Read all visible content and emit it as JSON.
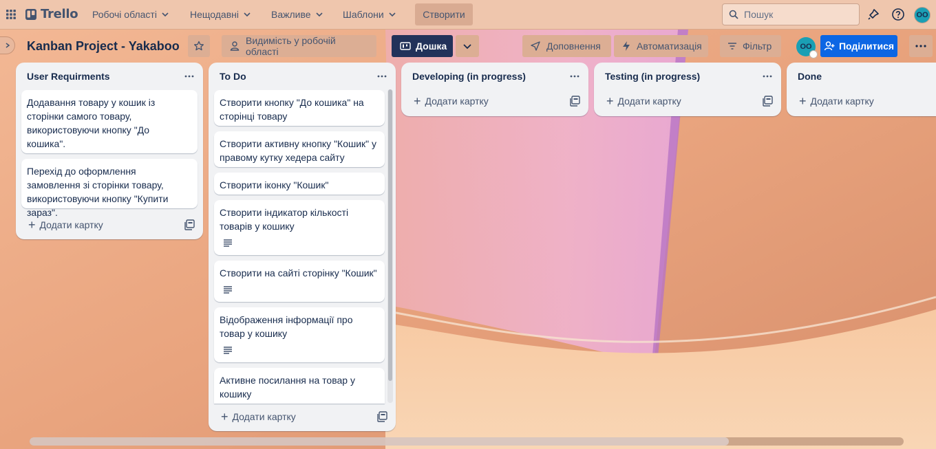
{
  "app": {
    "name": "Trello"
  },
  "topnav": {
    "menus": [
      "Робочі області",
      "Нещодавні",
      "Важливе",
      "Шаблони"
    ],
    "create_label": "Створити",
    "search_placeholder": "Пошук",
    "avatar_initials": "OO"
  },
  "board": {
    "title": "Kanban Project - Yakaboo",
    "visibility_label": "Видимість у робочій області",
    "view_label": "Дошка",
    "powerups_label": "Доповнення",
    "automation_label": "Автоматизація",
    "filter_label": "Фільтр",
    "member_initials": "OO",
    "share_label": "Поділитися"
  },
  "lists": [
    {
      "title": "User Requirments",
      "cards": [
        {
          "text": "Додавання товару у кошик із сторінки самого товару, використовуючи кнопку \"До кошика\".",
          "has_description": false
        },
        {
          "text": "Перехід до оформлення замовлення зі сторінки товару, використовуючи кнопку \"Купити зараз\".",
          "has_description": false
        }
      ],
      "add_label": "Додати картку"
    },
    {
      "title": "To Do",
      "cards": [
        {
          "text": "Створити кнопку \"До кошика\" на сторінці товару",
          "has_description": false
        },
        {
          "text": "Створити активну кнопку \"Кошик\" у правому кутку хедера сайту",
          "has_description": false
        },
        {
          "text": "Створити іконку \"Кошик\"",
          "has_description": false
        },
        {
          "text": "Створити індикатор кількості товарів у кошику",
          "has_description": true
        },
        {
          "text": "Створити на сайті сторінку \"Кошик\"",
          "has_description": true
        },
        {
          "text": "Відображення інформації про товар у кошику",
          "has_description": true
        },
        {
          "text": "Активне посилання на товар у кошику",
          "has_description": false
        }
      ],
      "add_label": "Додати картку"
    },
    {
      "title": "Developing (in progress)",
      "cards": [],
      "add_label": "Додати картку"
    },
    {
      "title": "Testing (in progress)",
      "cards": [],
      "add_label": "Додати картку"
    },
    {
      "title": "Done",
      "cards": [],
      "add_label": "Додати картку"
    }
  ],
  "colors": {
    "share_button": "#0c66e4",
    "board_view_button": "#22325a",
    "avatar": "#1a9fb4",
    "list_background": "#f1f2f4"
  }
}
